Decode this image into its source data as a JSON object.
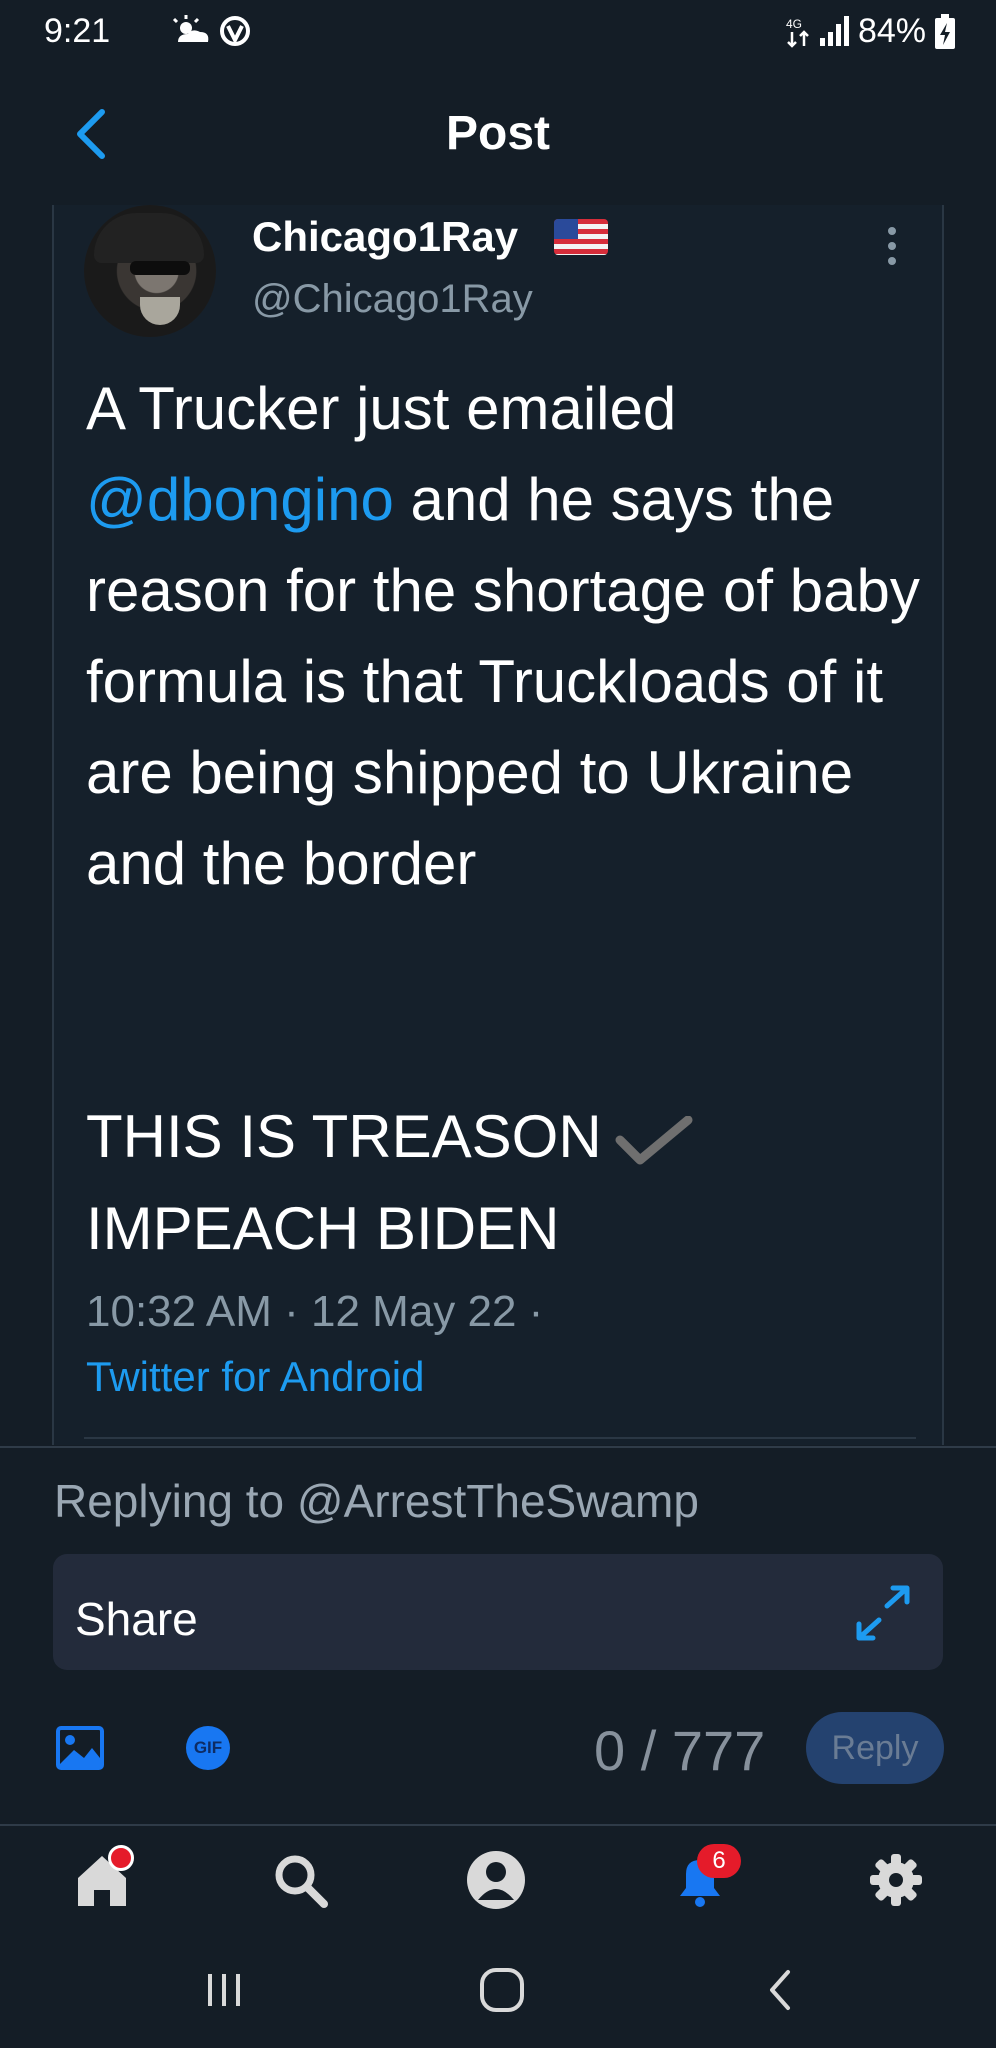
{
  "status_bar": {
    "time": "9:21",
    "battery": "84%",
    "icons": [
      "weather-icon",
      "vpn-icon",
      "data-arrows-icon",
      "signal-icon",
      "battery-charging-icon"
    ]
  },
  "header": {
    "title": "Post",
    "back_icon": "chevron-left-icon"
  },
  "post": {
    "author_name": "Chicago1Ray",
    "author_handle": "@Chicago1Ray",
    "body_prefix": "A Trucker just emailed",
    "mention": "@dbongino",
    "body_rest": " and he says the reason for the shortage of baby formula is that Truckloads of it are being shipped to Ukraine and the border",
    "emphasis_line1": "THIS IS TREASON",
    "emphasis_line2": "IMPEACH BIDEN",
    "timestamp": "10:32 AM · 12 May 22 ·",
    "source": "Twitter for Android"
  },
  "composer": {
    "replying_to": "Replying to @ArrestTheSwamp",
    "input_value": "Share",
    "gif_label": "GIF",
    "counter": "0 / 777",
    "reply_label": "Reply"
  },
  "tab_bar": {
    "tabs": [
      "home-icon",
      "search-icon",
      "profile-icon",
      "notifications-icon",
      "settings-icon"
    ],
    "notification_count": "6"
  },
  "colors": {
    "background": "#141d26",
    "accent": "#1d9bf0",
    "badge": "#e51b2a"
  }
}
